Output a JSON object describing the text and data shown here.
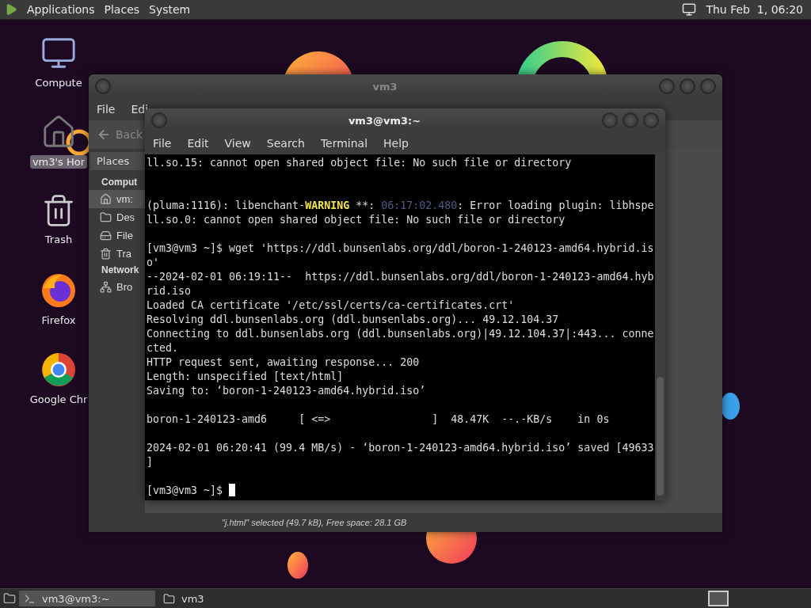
{
  "top_panel": {
    "menus": [
      "Applications",
      "Places",
      "System"
    ],
    "clock": "Thu Feb  1, 06:20"
  },
  "desktop_icons": [
    {
      "label": "Compute",
      "kind": "computer",
      "selected": false
    },
    {
      "label": "vm3's Hor",
      "kind": "home",
      "selected": true
    },
    {
      "label": "Trash",
      "kind": "trash",
      "selected": false
    },
    {
      "label": "Firefox",
      "kind": "firefox",
      "selected": false
    },
    {
      "label": "Google Chr",
      "kind": "chrome",
      "selected": false
    }
  ],
  "file_manager": {
    "title": "vm3",
    "menu": [
      "File",
      "Edi"
    ],
    "back": "Back",
    "sidebar": {
      "header": "Places",
      "sections": [
        {
          "title": "Comput",
          "items": [
            {
              "label": "vm:",
              "kind": "home",
              "selected": true
            },
            {
              "label": "Des",
              "kind": "folder",
              "selected": false
            },
            {
              "label": "File",
              "kind": "drive",
              "selected": false
            },
            {
              "label": "Tra",
              "kind": "trash",
              "selected": false
            }
          ]
        },
        {
          "title": "Network",
          "items": [
            {
              "label": "Bro",
              "kind": "network",
              "selected": false
            }
          ]
        }
      ]
    },
    "status": "\"j.html\" selected (49.7 kB), Free space: 28.1 GB"
  },
  "terminal": {
    "title": "vm3@vm3:~",
    "menu": [
      "File",
      "Edit",
      "View",
      "Search",
      "Terminal",
      "Help"
    ],
    "lines": [
      {
        "kind": "text",
        "segments": [
          {
            "text": "ll.so.15: cannot open shared object file: No such file or directory",
            "kind": "plain"
          }
        ]
      },
      {
        "kind": "blank"
      },
      {
        "kind": "blank"
      },
      {
        "kind": "text",
        "segments": [
          {
            "text": "(pluma:1116): libenchant-",
            "kind": "plain"
          },
          {
            "text": "WARNING",
            "kind": "warning"
          },
          {
            "text": " **: ",
            "kind": "plain"
          },
          {
            "text": "06:17:02.480",
            "kind": "time"
          },
          {
            "text": ": Error loading plugin: libhspe",
            "kind": "plain"
          }
        ]
      },
      {
        "kind": "text",
        "segments": [
          {
            "text": "ll.so.0: cannot open shared object file: No such file or directory",
            "kind": "plain"
          }
        ]
      },
      {
        "kind": "blank"
      },
      {
        "kind": "text",
        "segments": [
          {
            "text": "[vm3@vm3 ~]$ wget 'https://ddl.bunsenlabs.org/ddl/boron-1-240123-amd64.hybrid.is",
            "kind": "plain"
          }
        ]
      },
      {
        "kind": "text",
        "segments": [
          {
            "text": "o'",
            "kind": "plain"
          }
        ]
      },
      {
        "kind": "text",
        "segments": [
          {
            "text": "--2024-02-01 06:19:11--  https://ddl.bunsenlabs.org/ddl/boron-1-240123-amd64.hyb",
            "kind": "plain"
          }
        ]
      },
      {
        "kind": "text",
        "segments": [
          {
            "text": "rid.iso",
            "kind": "plain"
          }
        ]
      },
      {
        "kind": "text",
        "segments": [
          {
            "text": "Loaded CA certificate '/etc/ssl/certs/ca-certificates.crt'",
            "kind": "plain"
          }
        ]
      },
      {
        "kind": "text",
        "segments": [
          {
            "text": "Resolving ddl.bunsenlabs.org (ddl.bunsenlabs.org)... 49.12.104.37",
            "kind": "plain"
          }
        ]
      },
      {
        "kind": "text",
        "segments": [
          {
            "text": "Connecting to ddl.bunsenlabs.org (ddl.bunsenlabs.org)|49.12.104.37|:443... conne",
            "kind": "plain"
          }
        ]
      },
      {
        "kind": "text",
        "segments": [
          {
            "text": "cted.",
            "kind": "plain"
          }
        ]
      },
      {
        "kind": "text",
        "segments": [
          {
            "text": "HTTP request sent, awaiting response... 200",
            "kind": "plain"
          }
        ]
      },
      {
        "kind": "text",
        "segments": [
          {
            "text": "Length: unspecified [text/html]",
            "kind": "plain"
          }
        ]
      },
      {
        "kind": "text",
        "segments": [
          {
            "text": "Saving to: ‘boron-1-240123-amd64.hybrid.iso’",
            "kind": "plain"
          }
        ]
      },
      {
        "kind": "blank"
      },
      {
        "kind": "text",
        "segments": [
          {
            "text": "boron-1-240123-amd6     [ <=>                ]  48.47K  --.-KB/s    in 0s",
            "kind": "plain"
          }
        ]
      },
      {
        "kind": "blank"
      },
      {
        "kind": "text",
        "segments": [
          {
            "text": "2024-02-01 06:20:41 (99.4 MB/s) - ‘boron-1-240123-amd64.hybrid.iso’ saved [49633",
            "kind": "plain"
          }
        ]
      },
      {
        "kind": "text",
        "segments": [
          {
            "text": "]",
            "kind": "plain"
          }
        ]
      },
      {
        "kind": "blank"
      },
      {
        "kind": "prompt",
        "segments": [
          {
            "text": "[vm3@vm3 ~]$ ",
            "kind": "plain"
          }
        ]
      }
    ]
  },
  "taskbar": {
    "items": [
      {
        "label": "vm3@vm3:~",
        "kind": "terminal",
        "selected": true
      },
      {
        "label": "vm3",
        "kind": "folder",
        "selected": false
      }
    ]
  }
}
